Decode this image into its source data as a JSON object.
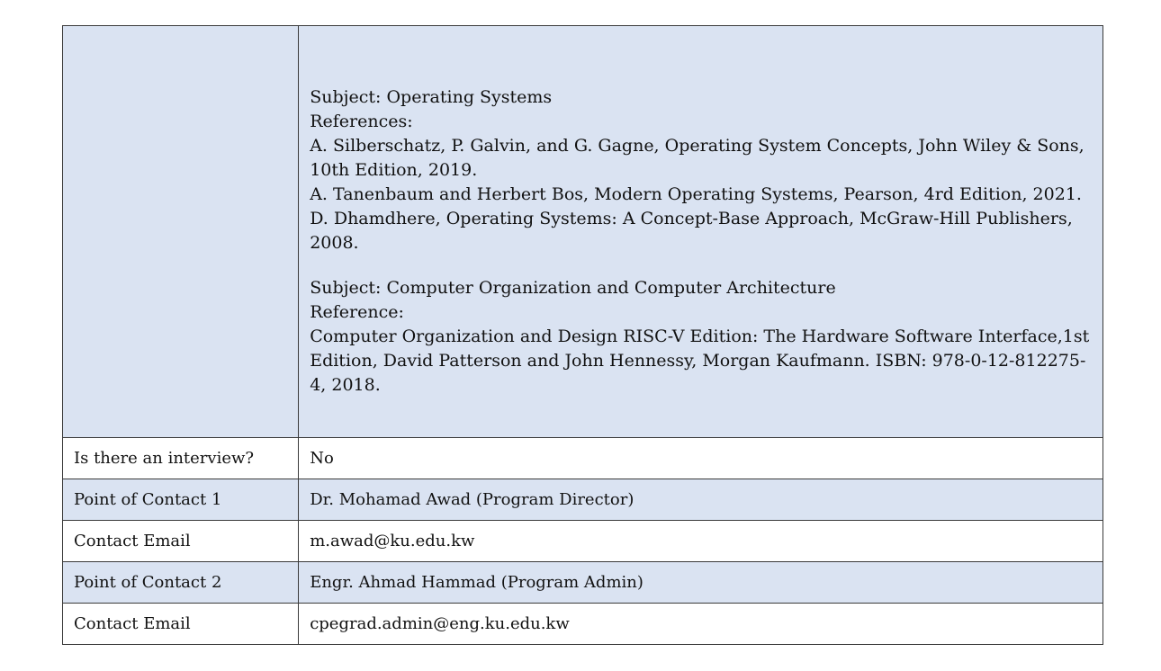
{
  "references_section": {
    "label": "",
    "blocks": [
      {
        "subject": "Subject: Operating Systems",
        "heading": "References:",
        "lines": [
          "A. Silberschatz, P. Galvin, and G. Gagne, Operating System Concepts, John Wiley & Sons, 10th Edition, 2019.",
          "A. Tanenbaum and Herbert Bos, Modern Operating Systems, Pearson, 4rd Edition, 2021.",
          "D. Dhamdhere, Operating Systems: A Concept-Base Approach, McGraw-Hill Publishers, 2008."
        ]
      },
      {
        "subject": "Subject: Computer Organization and Computer Architecture",
        "heading": "Reference:",
        "lines": [
          "Computer Organization and Design RISC-V Edition: The Hardware Software Interface,1st Edition, David Patterson and John Hennessy, Morgan Kaufmann. ISBN: 978-0-12-812275-4, 2018."
        ]
      }
    ]
  },
  "rows": [
    {
      "label": "Is there an interview?",
      "value": "No"
    },
    {
      "label": "Point of Contact 1",
      "value": "Dr. Mohamad Awad (Program Director)"
    },
    {
      "label": "Contact Email",
      "value": "m.awad@ku.edu.kw"
    },
    {
      "label": "Point of Contact 2",
      "value": "Engr. Ahmad Hammad (Program Admin)"
    },
    {
      "label": "Contact Email",
      "value": "cpegrad.admin@eng.ku.edu.kw"
    }
  ],
  "colors": {
    "shaded_row": "#dae3f2",
    "plain_row": "#ffffff",
    "border": "#3a3a3a"
  }
}
